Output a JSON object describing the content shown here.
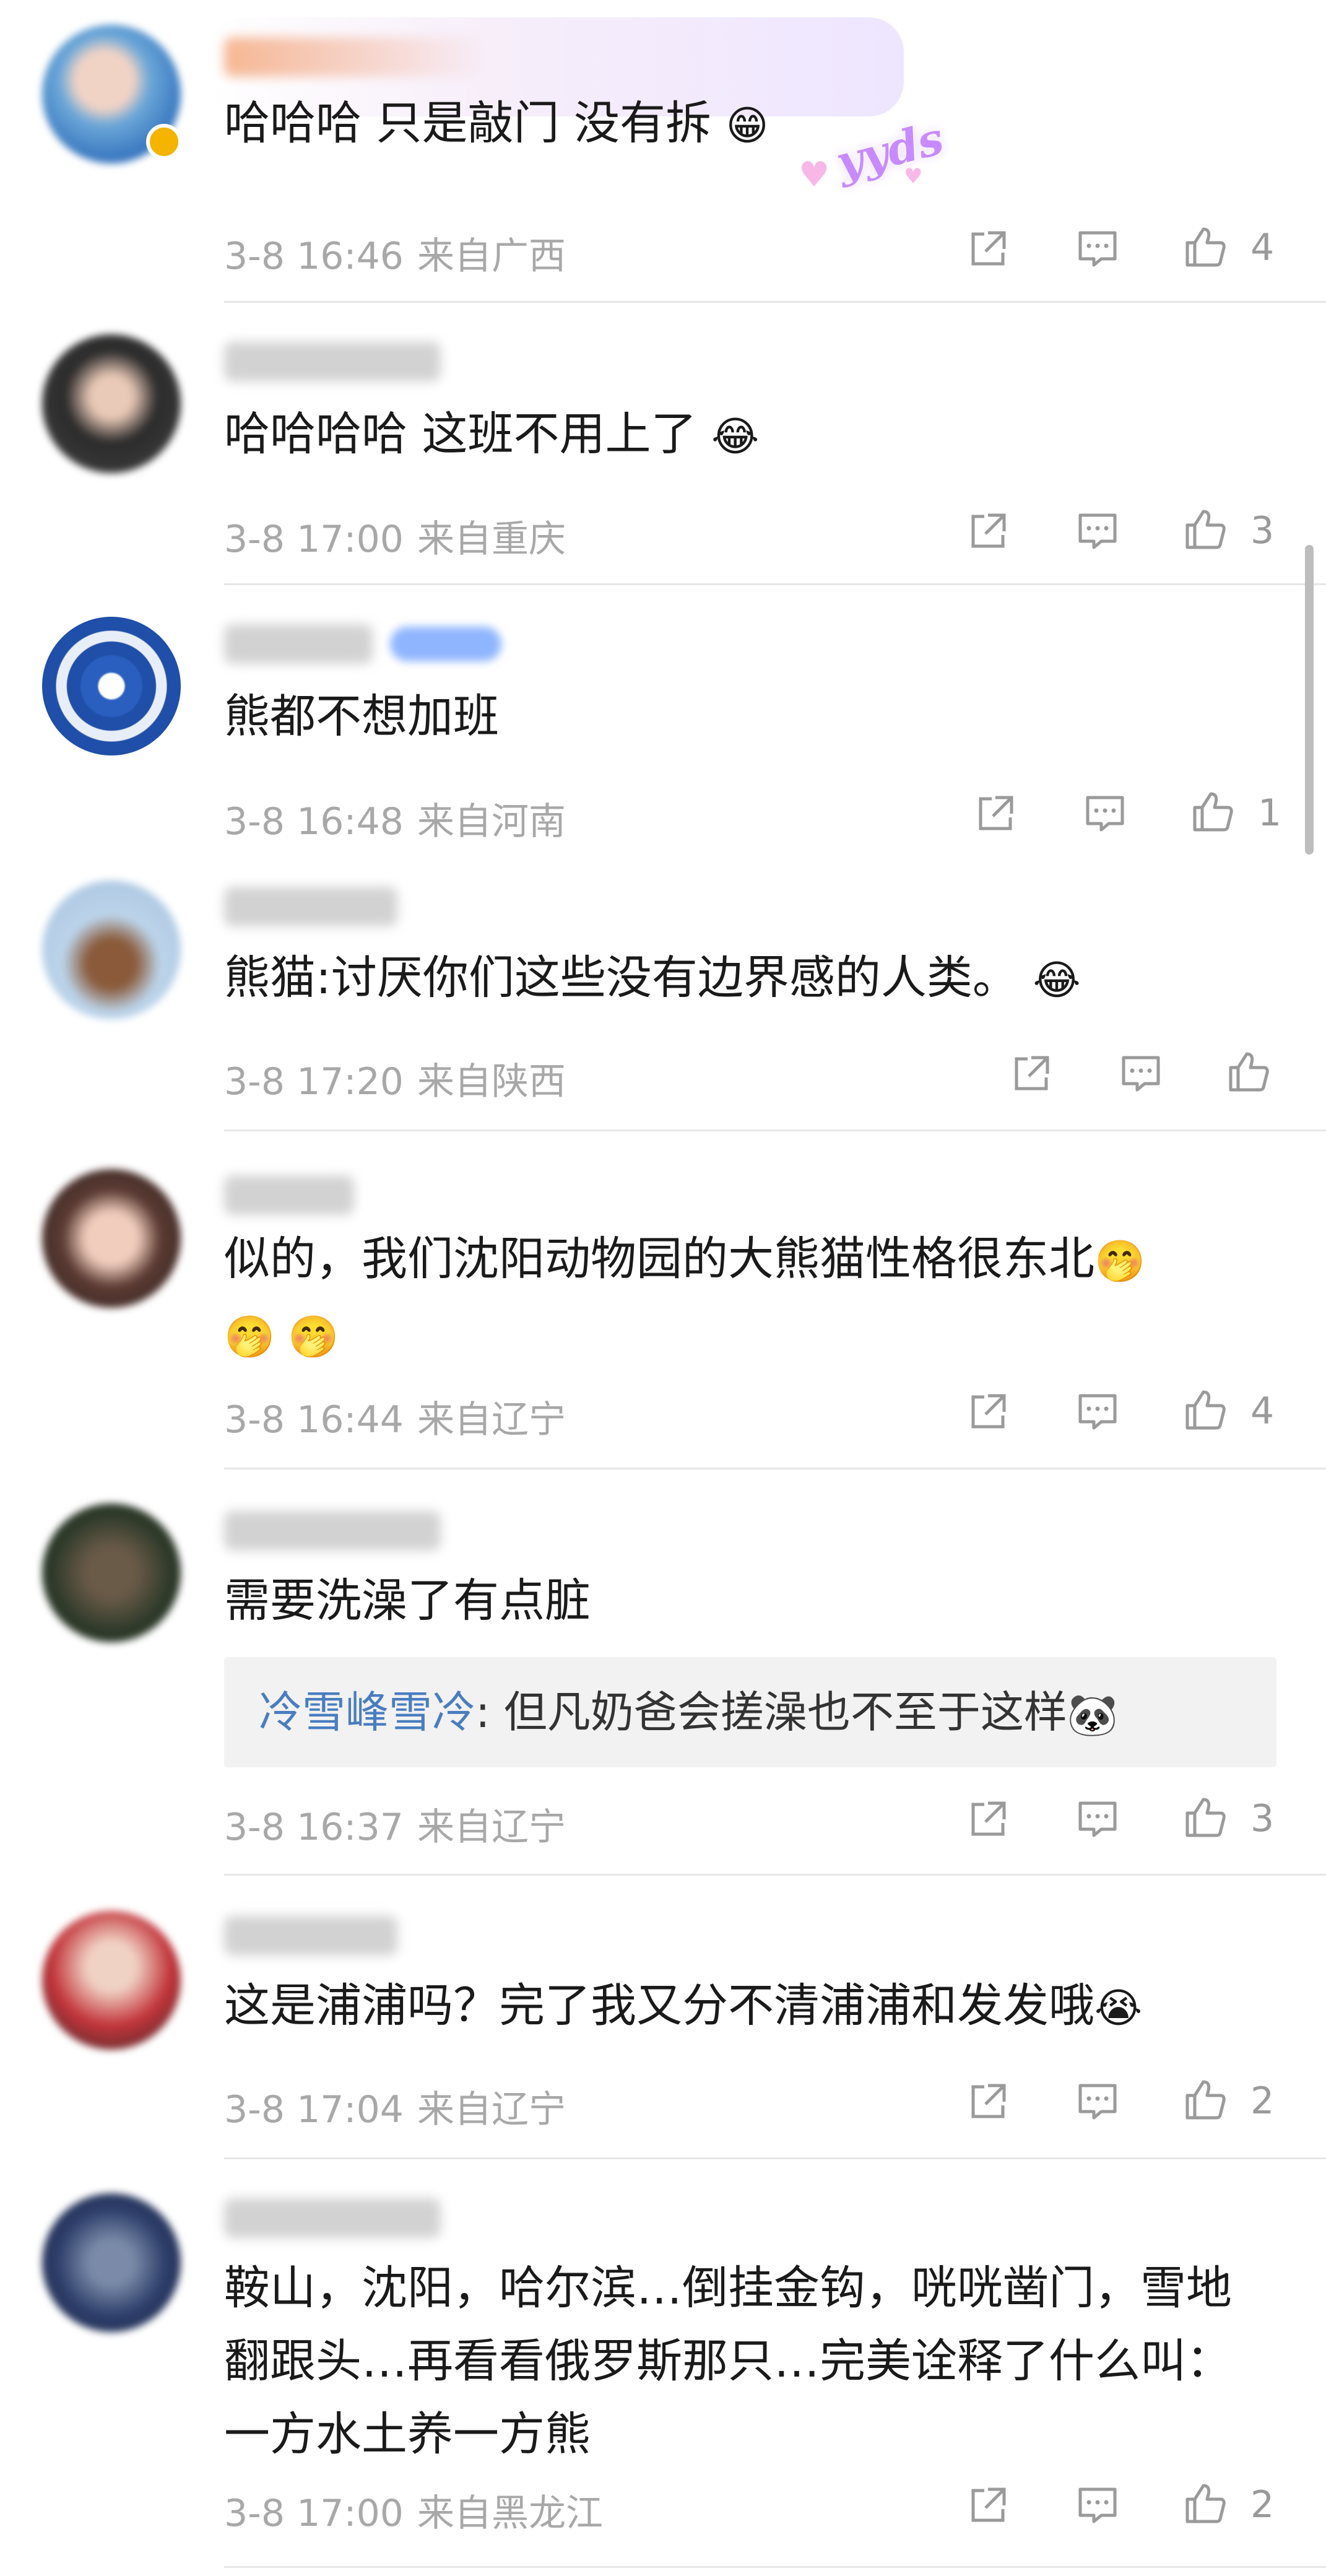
{
  "colors": {
    "text": "#1a1a1a",
    "meta": "#a8a8a8",
    "link": "#4a7dc0",
    "divider": "#e6e6e6",
    "reply_bg": "#f2f2f2"
  },
  "icons": {
    "share": "share-icon",
    "comment": "comment-icon",
    "like": "thumbs-up-icon"
  },
  "decoration": {
    "yyds": "yyds"
  },
  "comments": [
    {
      "text": "哈哈哈 只是敲门 没有拆",
      "emoji": "😁",
      "time": "3-8 16:46",
      "location": "来自广西",
      "likes": "4"
    },
    {
      "text": "哈哈哈哈  这班不用上了",
      "emoji": "😂",
      "time": "3-8 17:00",
      "location": "来自重庆",
      "likes": "3"
    },
    {
      "text": "熊都不想加班",
      "emoji": "",
      "time": "3-8 16:48",
      "location": "来自河南",
      "likes": "1"
    },
    {
      "text": "熊猫:讨厌你们这些没有边界感的人类。",
      "emoji": "😂",
      "time": "3-8 17:20",
      "location": "来自陕西",
      "likes": ""
    },
    {
      "text": "似的，我们沈阳动物园的大熊猫性格很东北",
      "emoji": "🤭",
      "emoji_line2": "🤭 🤭",
      "time": "3-8 16:44",
      "location": "来自辽宁",
      "likes": "4"
    },
    {
      "text": "需要洗澡了有点脏",
      "emoji": "",
      "reply_user": "冷雪峰雪冷",
      "reply_text": ": 但凡奶爸会搓澡也不至于这样",
      "reply_emoji": "🐼",
      "time": "3-8 16:37",
      "location": "来自辽宁",
      "likes": "3"
    },
    {
      "text": "这是浦浦吗？完了我又分不清浦浦和发发哦",
      "emoji": "😭",
      "time": "3-8 17:04",
      "location": "来自辽宁",
      "likes": "2"
    },
    {
      "text": "鞍山，沈阳，哈尔滨…倒挂金钩，咣咣凿门，雪地翻跟头…再看看俄罗斯那只…完美诠释了什么叫：一方水土养一方熊",
      "emoji": "",
      "time": "3-8 17:00",
      "location": "来自黑龙江",
      "likes": "2"
    }
  ]
}
